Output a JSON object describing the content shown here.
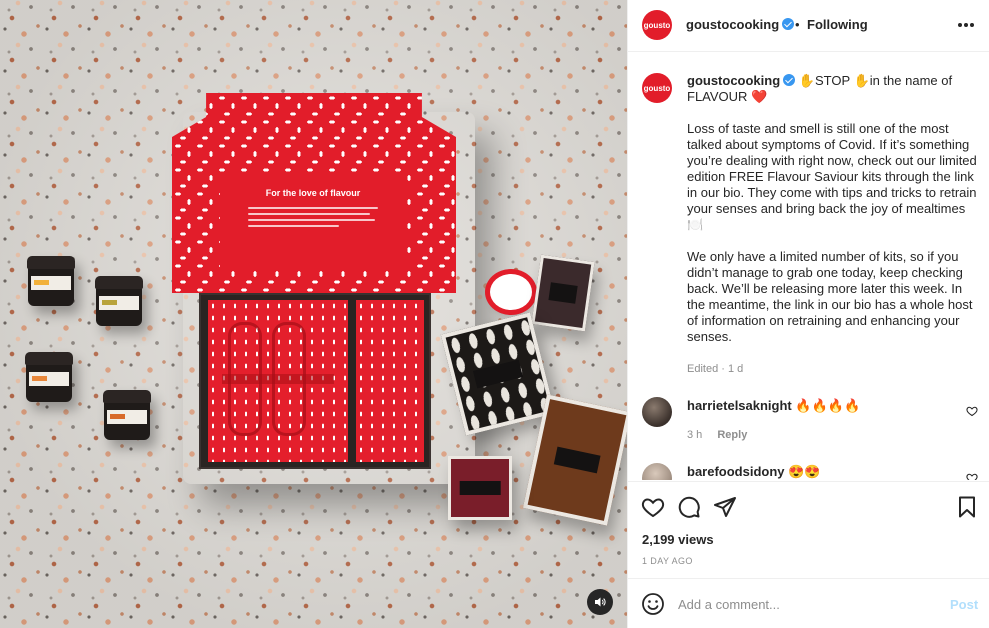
{
  "media": {
    "lid_heading": "For the love of flavour"
  },
  "header": {
    "avatar_text": "gousto",
    "username": "goustocooking",
    "separator": "•",
    "follow_status": "Following"
  },
  "caption": {
    "avatar_text": "gousto",
    "username": "goustocooking",
    "first_line": "✋STOP ✋in the name of FLAVOUR ❤️",
    "paragraph_1": "Loss of taste and smell is still one of the most talked about symptoms of Covid. If it’s something you’re dealing with right now, check out our limited edition FREE Flavour Saviour kits through the link in our bio. They come with tips and tricks to retrain your senses and bring back the joy of mealtimes 🍽️",
    "paragraph_2": "We only have a limited number of kits, so if you didn’t manage to grab one today, keep checking back. We’ll be releasing more later this week. In the meantime, the link in our bio has a whole host of information on retraining and enhancing your senses.",
    "edited": "Edited · 1 d"
  },
  "comments": [
    {
      "username": "harrietelsaknight",
      "text": "🔥🔥🔥🔥",
      "time": "3 h",
      "reply_label": "Reply"
    },
    {
      "username": "barefoodsidony",
      "text": "😍😍"
    }
  ],
  "stats": {
    "views": "2,199 views",
    "posted": "1 DAY AGO"
  },
  "composer": {
    "placeholder": "Add a comment...",
    "post_label": "Post"
  },
  "icons": {
    "heart": "heart-icon",
    "comment": "comment-icon",
    "share": "share-icon",
    "save": "bookmark-icon",
    "emoji": "emoji-icon",
    "more": "more-icon",
    "audio": "speaker-icon",
    "verified": "verified-badge-icon"
  },
  "colors": {
    "brand_red": "#e21d2a",
    "verified_blue": "#3897f0",
    "post_disabled": "#b2dffc",
    "muted_text": "#8e8e8e"
  }
}
